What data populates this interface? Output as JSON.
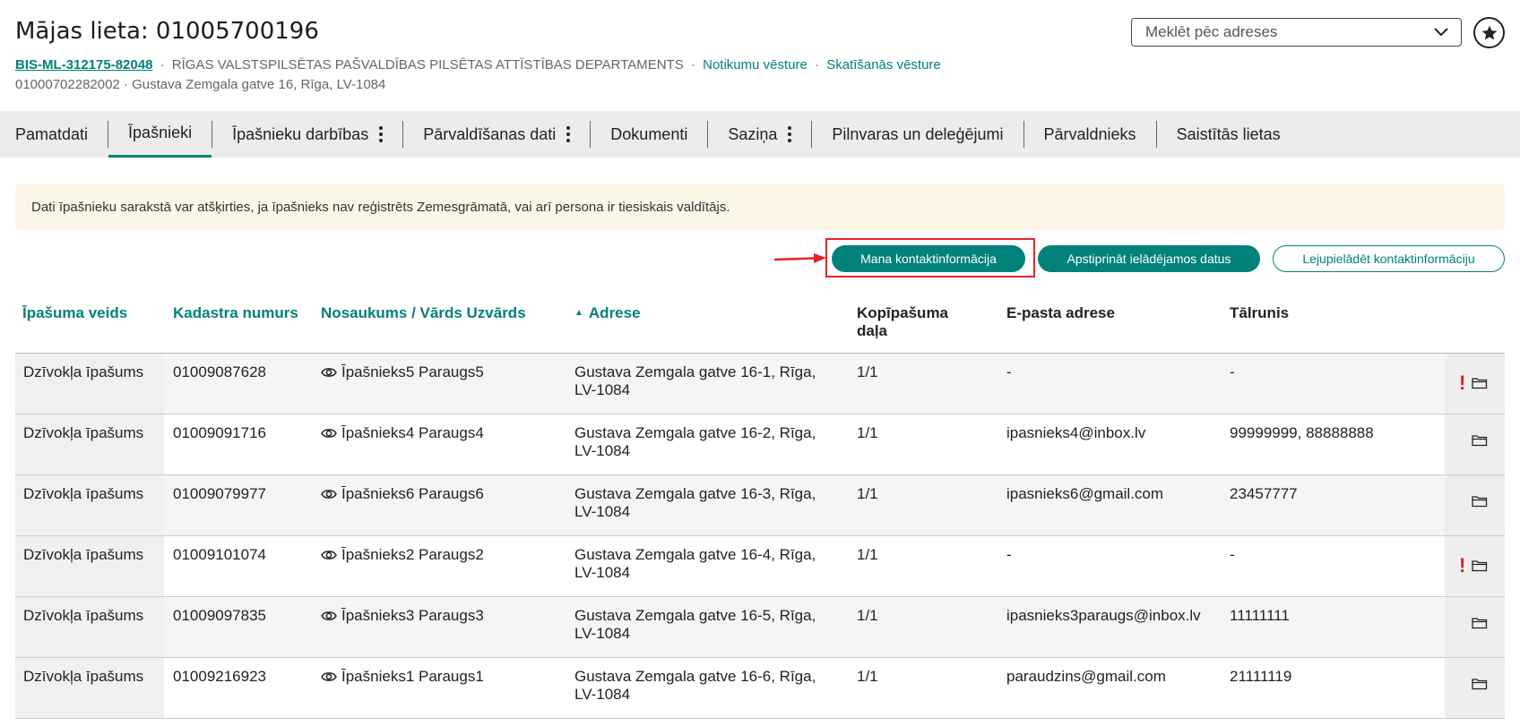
{
  "header": {
    "title": "Mājas lieta: 01005700196",
    "case_id": "BIS-ML-312175-82048",
    "department": "RĪGAS VALSTSPILSĒTAS PAŠVALDĪBAS PILSĒTAS ATTĪSTĪBAS DEPARTAMENTS",
    "separator": "·",
    "events_link": "Notikumu vēsture",
    "views_link": "Skatīšanās vēsture",
    "sub_line": "01000702282002 · Gustava Zemgala gatve 16, Rīga, LV-1084"
  },
  "address_search": {
    "placeholder": "Meklēt pēc adreses"
  },
  "tabs": [
    {
      "label": "Pamatdati"
    },
    {
      "label": "Īpašnieki"
    },
    {
      "label": "Īpašnieku darbības"
    },
    {
      "label": "Pārvaldīšanas dati"
    },
    {
      "label": "Dokumenti"
    },
    {
      "label": "Saziņa"
    },
    {
      "label": "Pilnvaras un deleģējumi"
    },
    {
      "label": "Pārvaldnieks"
    },
    {
      "label": "Saistītās lietas"
    }
  ],
  "notice": "Dati īpašnieku sarakstā var atšķirties, ja īpašnieks nav reģistrēts Zemesgrāmatā, vai arī persona ir tiesiskais valdītājs.",
  "actions": {
    "my_contact": "Mana kontaktinformācija",
    "confirm_data": "Apstiprināt ielādējamos datus",
    "download_contacts": "Lejupielādēt kontaktinformāciju"
  },
  "table": {
    "headers": {
      "property_type": "Īpašuma veids",
      "cadastre": "Kadastra numurs",
      "name": "Nosaukums / Vārds Uzvārds",
      "address": "Adrese",
      "share_1": "Kopīpašuma",
      "share_2": "daļa",
      "email": "E-pasta adrese",
      "phone": "Tālrunis"
    },
    "rows": [
      {
        "type": "Dzīvokļa īpašums",
        "cadastre": "01009087628",
        "name": "Īpašnieks5 Paraugs5",
        "addr1": "Gustava Zemgala gatve 16-1, Rīga,",
        "addr2": "LV-1084",
        "share": "1/1",
        "email": "-",
        "phone": "-",
        "warning": "!"
      },
      {
        "type": "Dzīvokļa īpašums",
        "cadastre": "01009091716",
        "name": "Īpašnieks4 Paraugs4",
        "addr1": "Gustava Zemgala gatve 16-2, Rīga,",
        "addr2": "LV-1084",
        "share": "1/1",
        "email": "ipasnieks4@inbox.lv",
        "phone": "99999999, 88888888",
        "warning": ""
      },
      {
        "type": "Dzīvokļa īpašums",
        "cadastre": "01009079977",
        "name": "Īpašnieks6 Paraugs6",
        "addr1": "Gustava Zemgala gatve 16-3, Rīga,",
        "addr2": "LV-1084",
        "share": "1/1",
        "email": "ipasnieks6@gmail.com",
        "phone": "23457777",
        "warning": ""
      },
      {
        "type": "Dzīvokļa īpašums",
        "cadastre": "01009101074",
        "name": "Īpašnieks2 Paraugs2",
        "addr1": "Gustava Zemgala gatve 16-4, Rīga,",
        "addr2": "LV-1084",
        "share": "1/1",
        "email": "-",
        "phone": "-",
        "warning": "!"
      },
      {
        "type": "Dzīvokļa īpašums",
        "cadastre": "01009097835",
        "name": "Īpašnieks3 Paraugs3",
        "addr1": "Gustava Zemgala gatve 16-5, Rīga,",
        "addr2": "LV-1084",
        "share": "1/1",
        "email": "ipasnieks3paraugs@inbox.lv",
        "phone": "11111111",
        "warning": ""
      },
      {
        "type": "Dzīvokļa īpašums",
        "cadastre": "01009216923",
        "name": "Īpašnieks1 Paraugs1",
        "addr1": "Gustava Zemgala gatve 16-6, Rīga,",
        "addr2": "LV-1084",
        "share": "1/1",
        "email": "paraudzins@gmail.com",
        "phone": "21111119",
        "warning": ""
      }
    ]
  },
  "colors": {
    "accent": "#00817a",
    "highlight": "#e8212a",
    "warning": "#d3202c",
    "notice_bg": "#fcf6e6"
  },
  "icons": {
    "select_chevron": "chevron-down-icon",
    "favorite": "star-icon",
    "row_view": "eye-icon",
    "row_folder": "folder-icon",
    "annotation": "red-arrow-icon"
  }
}
